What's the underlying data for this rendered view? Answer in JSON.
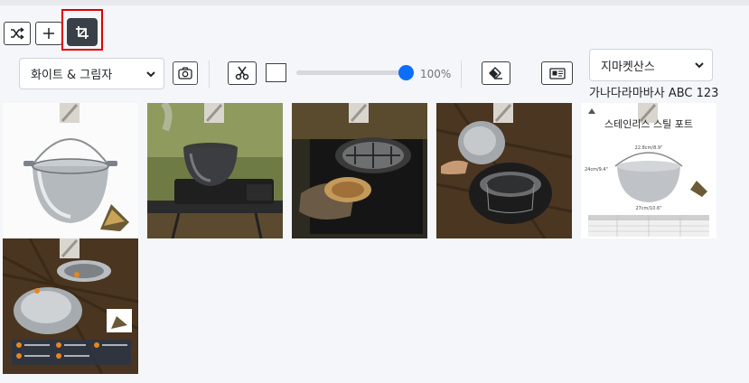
{
  "toolbar": {
    "shuffle_icon": "shuffle-icon",
    "add_icon": "plus-icon",
    "crop_icon": "crop-icon",
    "highlight_color": "#e00000"
  },
  "controls": {
    "background_select": {
      "value": "화이트 & 그림자"
    },
    "camera_icon": "camera-icon",
    "scissors_icon": "scissors-icon",
    "opacity": {
      "value": 100,
      "label": "100%"
    },
    "eraser_icon": "eraser-icon",
    "textcard_icon": "text-card-icon",
    "font_select": {
      "value": "지마켓산스"
    },
    "font_preview": "가나다라마바사 ABC 123"
  },
  "gallery": {
    "product_title_overlay": "스테인리스 스틸 포트",
    "spec_width": "22.8cm/8.9\"",
    "spec_height": "24cm/9.4\"",
    "spec_depth": "27cm/10.6\"",
    "images": [
      "pot-white-background",
      "pot-on-camp-stove",
      "pot-on-grill-grate",
      "pot-in-stove-ring",
      "pot-spec-sheet",
      "pot-components-infographic"
    ]
  },
  "colors": {
    "accent": "#0d6efd",
    "dark_button": "#3a4047"
  }
}
